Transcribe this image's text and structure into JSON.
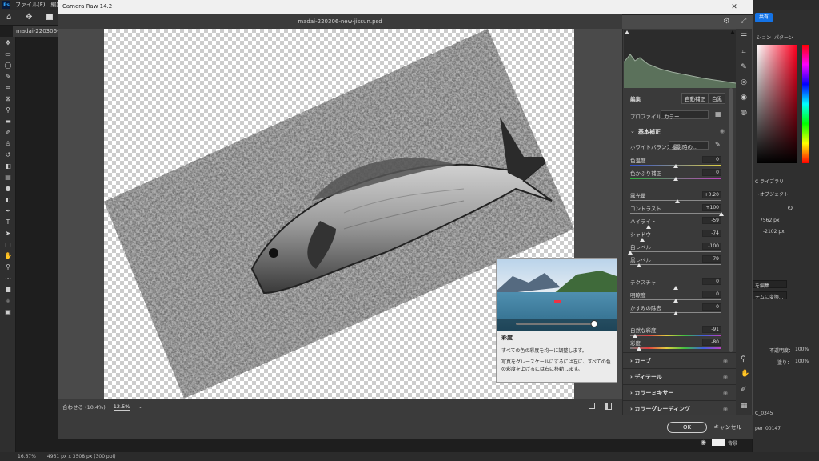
{
  "ps": {
    "logo": "Ps",
    "menu": [
      "ファイル(F)",
      "編集(E)"
    ],
    "doc_tab": "madai-220306-n",
    "status_zoom": "16.67%",
    "status_size": "4961 px x 3508 px (300 ppi)",
    "share": "共有",
    "panel_tabs": [
      "ション",
      "パターン"
    ],
    "library_label": "C ライブラリ",
    "smart_object_label": "トオブジェクト",
    "w_value": "7562 px",
    "h_value": "-2102 px",
    "edit_btn": "を編集",
    "convert_btn": "テムに変換...",
    "opacity_label": "不透明度：",
    "opacity_value": "100%",
    "fill_label": "塗り：",
    "fill_value": "100%",
    "layer1": "C_0345",
    "layer2": "per_00147",
    "layer3": "背景"
  },
  "dialog": {
    "title": "Camera Raw 14.2",
    "filename": "madai-220306-new-jissun.psd",
    "zoom_fit": "合わせる (10.4%)",
    "zoom_value": "12.5%",
    "ok": "OK",
    "cancel": "キャンセル"
  },
  "panel": {
    "edit_label": "編集",
    "auto_btn": "自動補正",
    "bw_btn": "白黒",
    "profile_label": "プロファイル",
    "profile_value": "カラー",
    "basic_section": "基本補正",
    "wb_label": "ホワイトバランス",
    "wb_value": "撮影時の...",
    "sliders": [
      {
        "label": "色温度",
        "value": "0",
        "pos": 0.5,
        "grad": "linear-gradient(to right,#3050d0,#e0d040)"
      },
      {
        "label": "色かぶり補正",
        "value": "0",
        "pos": 0.5,
        "grad": "linear-gradient(to right,#30b040,#c040c0)"
      },
      {
        "label": "露光量",
        "value": "+0.20",
        "pos": 0.52,
        "grad": ""
      },
      {
        "label": "コントラスト",
        "value": "+100",
        "pos": 1.0,
        "grad": ""
      },
      {
        "label": "ハイライト",
        "value": "-59",
        "pos": 0.2,
        "grad": ""
      },
      {
        "label": "シャドウ",
        "value": "-74",
        "pos": 0.13,
        "grad": ""
      },
      {
        "label": "白レベル",
        "value": "-100",
        "pos": 0.0,
        "grad": ""
      },
      {
        "label": "黒レベル",
        "value": "-79",
        "pos": 0.1,
        "grad": ""
      },
      {
        "label": "テクスチャ",
        "value": "0",
        "pos": 0.5,
        "grad": ""
      },
      {
        "label": "明瞭度",
        "value": "0",
        "pos": 0.5,
        "grad": ""
      },
      {
        "label": "かすみの除去",
        "value": "0",
        "pos": 0.5,
        "grad": ""
      },
      {
        "label": "自然な彩度",
        "value": "-91",
        "pos": 0.05,
        "grad": "linear-gradient(to right,#777,#e04040,#e0d040,#40c040,#4060e0,#c040c0)"
      },
      {
        "label": "彩度",
        "value": "-80",
        "pos": 0.1,
        "grad": "linear-gradient(to right,#777,#e04040,#e0d040,#40c040,#4060e0,#c040c0)"
      }
    ],
    "sections": [
      "カーブ",
      "ディテール",
      "カラーミキサー",
      "カラーグレーディング"
    ]
  },
  "tooltip": {
    "title": "彩度",
    "line1": "すべての色の彩度を均一に調整します。",
    "line2": "写真をグレースケールにするには左に、すべての色の彩度を上げるには右に移動します。"
  }
}
